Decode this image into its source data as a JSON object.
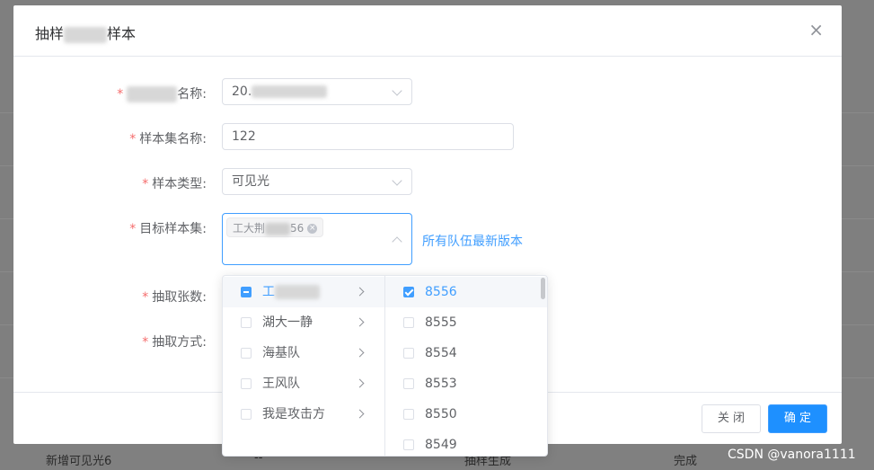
{
  "background": {
    "row_text": [
      "新增可见光6",
      "--",
      "抽样生成",
      "完成"
    ]
  },
  "modal": {
    "title_prefix": "抽样",
    "title_suffix": "样本",
    "close_glyph": "×"
  },
  "form": {
    "field1": {
      "label_suffix": "名称:",
      "value_prefix": "20."
    },
    "field2": {
      "label": "样本集名称:",
      "value": "122"
    },
    "field3": {
      "label": "样本类型:",
      "value": "可见光"
    },
    "field4": {
      "label": "目标样本集:",
      "tag_prefix": "工大荆",
      "tag_suffix": "56",
      "tag_close": "×",
      "link": "所有队伍最新版本"
    },
    "field5": {
      "label": "抽取张数:"
    },
    "field6": {
      "label": "抽取方式:"
    },
    "required_mark": "*"
  },
  "cascader": {
    "left_items": [
      {
        "label": "工",
        "state": "indeterminate"
      },
      {
        "label": "湖大一静",
        "state": "unchecked"
      },
      {
        "label": "海基队",
        "state": "unchecked"
      },
      {
        "label": "王风队",
        "state": "unchecked"
      },
      {
        "label": "我是攻击方",
        "state": "unchecked"
      }
    ],
    "right_items": [
      {
        "label": "8556",
        "state": "checked"
      },
      {
        "label": "8555",
        "state": "unchecked"
      },
      {
        "label": "8554",
        "state": "unchecked"
      },
      {
        "label": "8553",
        "state": "unchecked"
      },
      {
        "label": "8550",
        "state": "unchecked"
      },
      {
        "label": "8549",
        "state": "unchecked"
      }
    ]
  },
  "footer": {
    "close_label": "关 闭",
    "confirm_label": "确 定"
  },
  "watermark": "CSDN @vanora1111",
  "colors": {
    "primary": "#409eff",
    "required": "#f56c6c",
    "overlay": "#7f7f7f"
  }
}
